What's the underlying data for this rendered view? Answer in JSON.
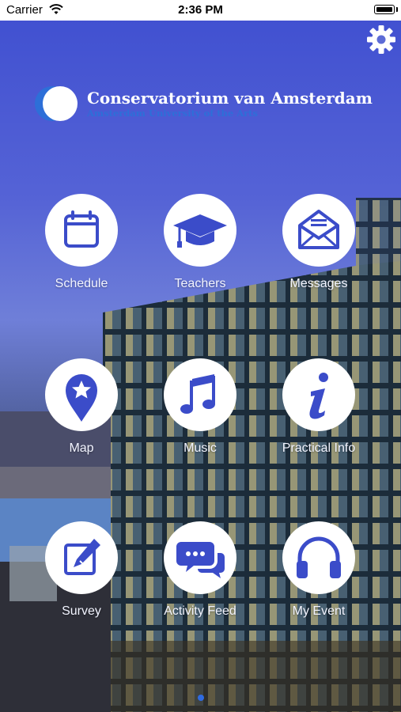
{
  "status_bar": {
    "carrier": "Carrier",
    "time": "2:36 PM"
  },
  "header": {
    "settings_icon": "gear-icon"
  },
  "logo": {
    "title": "Conservatorium van Amsterdam",
    "subtitle": "Amsterdam University of the Arts"
  },
  "tiles": [
    {
      "label": "Schedule",
      "icon": "calendar-icon"
    },
    {
      "label": "Teachers",
      "icon": "graduation-cap-icon"
    },
    {
      "label": "Messages",
      "icon": "envelope-icon"
    },
    {
      "label": "Map",
      "icon": "map-pin-star-icon"
    },
    {
      "label": "Music",
      "icon": "music-note-icon"
    },
    {
      "label": "Practical Info",
      "icon": "info-icon"
    },
    {
      "label": "Survey",
      "icon": "pencil-edit-icon"
    },
    {
      "label": "Activity Feed",
      "icon": "chat-bubbles-icon"
    },
    {
      "label": "My Event",
      "icon": "headphones-icon"
    }
  ],
  "pager": {
    "active_page": 1
  },
  "colors": {
    "icon": "#3b4cc9",
    "accent": "#2f6be0"
  }
}
